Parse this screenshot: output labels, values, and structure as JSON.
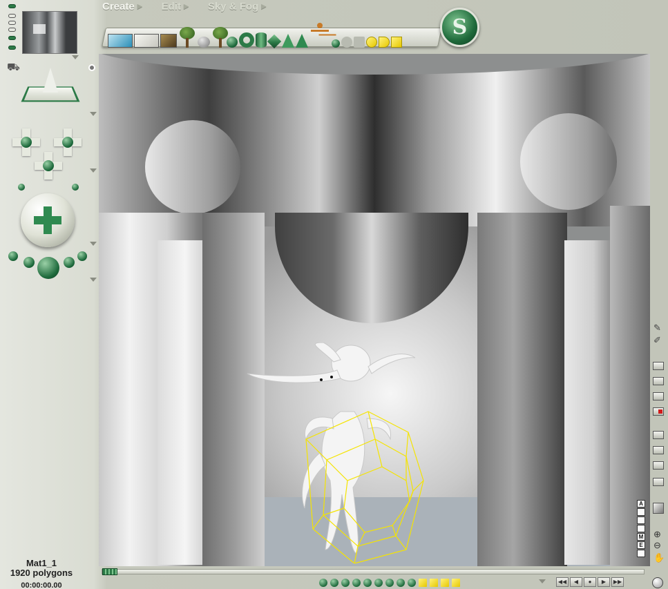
{
  "menu": {
    "create": "Create",
    "edit": "Edit",
    "sky_fog": "Sky & Fog"
  },
  "toolbar_items": [
    "water-plane",
    "ground-plane",
    "infinite-plane",
    "terrain",
    "tree",
    "rock",
    "plant",
    "sphere",
    "torus",
    "cylinder",
    "cube",
    "pyramid",
    "cone",
    "figure",
    "gray-sphere",
    "gray-cube",
    "gray-cylinder",
    "yellow-sphere",
    "yellow-cone",
    "yellow-cube"
  ],
  "info": {
    "object_name": "Mat1_1",
    "polygon_count": "1920 polygons",
    "timecode": "00:00:00.00"
  },
  "right_mini_labels": [
    "A",
    "",
    "",
    "",
    "M",
    "E",
    ""
  ],
  "colors": {
    "accent_green": "#2c7a47",
    "selection_yellow": "#f5e400",
    "panel_bg": "#c2c5b9"
  }
}
